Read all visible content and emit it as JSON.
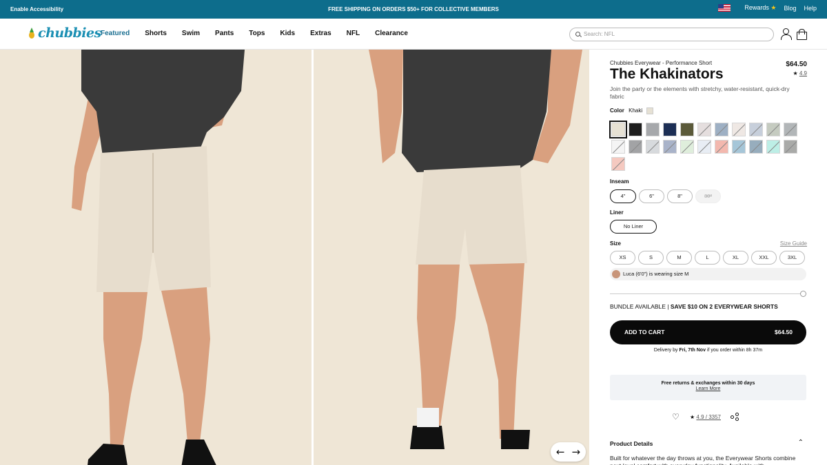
{
  "topbar": {
    "accessibility": "Enable Accessibility",
    "shipping": "FREE SHIPPING ON ORDERS $50+ FOR COLLECTIVE MEMBERS",
    "rewards": "Rewards",
    "blog": "Blog",
    "help": "Help"
  },
  "nav": {
    "logo": "chubbies",
    "items": [
      "Featured",
      "Shorts",
      "Swim",
      "Pants",
      "Tops",
      "Kids",
      "Extras",
      "NFL",
      "Clearance"
    ],
    "search_placeholder": "Search: NFL"
  },
  "gallery": {
    "prev": "←",
    "next": "→"
  },
  "product": {
    "subtitle": "Chubbies Everywear - Performance Short",
    "title": "The Khakinators",
    "price": "$64.50",
    "rating": "4.9",
    "description": "Join the party or the elements with stretchy, water-resistant, quick-dry fabric",
    "color_label": "Color",
    "color_value": "Khaki",
    "colors": [
      "#e6e1d4",
      "#1e1e1e",
      "#a6a8ab",
      "#1d2f55",
      "#5b5a3a",
      "#e5dede",
      "#9eb0c4",
      "#efe8e4",
      "#c7cfdb",
      "#c5cbc0",
      "#b2b6b8",
      "#f4f4f4",
      "#a2a3a5",
      "#d7dadd",
      "#a9b3c9",
      "#dfeedc",
      "#e8edf4",
      "#f3b8ae",
      "#a6c6d8",
      "#97adbd",
      "#bdeee6",
      "#a9aaa8",
      "#f5c9c0"
    ],
    "inseam_label": "Inseam",
    "inseam": [
      "4\"",
      "6\"",
      "8\"",
      "30\""
    ],
    "liner_label": "Liner",
    "liner": "No Liner",
    "size_label": "Size",
    "size_guide": "Size Guide",
    "sizes": [
      "XS",
      "S",
      "M",
      "L",
      "XL",
      "XXL",
      "3XL"
    ],
    "model_note": "Luca (6'0\") is wearing size M",
    "bundle_prefix": "BUNDLE AVAILABLE |",
    "bundle_offer": "SAVE $10 ON 2 EVERYWEAR SHORTS",
    "add_to_cart": "ADD TO CART",
    "cart_price": "$64.50",
    "delivery_prefix": "Delivery by",
    "delivery_date": "Fri, 7th Nov",
    "delivery_suffix": "if you order within 8h 37m",
    "returns": "Free returns & exchanges within 30 days",
    "learn_more": "Learn More",
    "review_summary": "4.9 / 3357",
    "details_title": "Product Details",
    "details_text": "Built for whatever the day throws at you, the Everywear Shorts combine next-level comfort with everyday functionality. Available with"
  }
}
